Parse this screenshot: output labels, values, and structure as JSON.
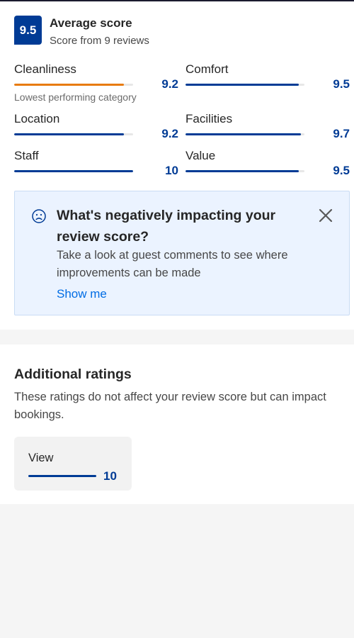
{
  "summary": {
    "score": "9.5",
    "title": "Average score",
    "subtitle": "Score from 9 reviews"
  },
  "ratings": [
    {
      "label": "Cleanliness",
      "value": "9.2",
      "fraction": 0.92,
      "note": "Lowest performing category",
      "bar_color": "#e87b0e"
    },
    {
      "label": "Comfort",
      "value": "9.5",
      "fraction": 0.95
    },
    {
      "label": "Location",
      "value": "9.2",
      "fraction": 0.92
    },
    {
      "label": "Facilities",
      "value": "9.7",
      "fraction": 0.97
    },
    {
      "label": "Staff",
      "value": "10",
      "fraction": 1.0
    },
    {
      "label": "Value",
      "value": "9.5",
      "fraction": 0.95
    }
  ],
  "banner": {
    "title": "What's negatively impacting your review score?",
    "text": "Take a look at guest comments to see where improvements can be made",
    "link": "Show me"
  },
  "additional": {
    "title": "Additional ratings",
    "description": "These ratings do not affect your review score but can impact bookings.",
    "items": [
      {
        "label": "View",
        "value": "10",
        "fraction": 1.0
      }
    ]
  },
  "colors": {
    "brand": "#003b95",
    "warning": "#e87b0e",
    "link": "#006ce4",
    "banner_bg": "#ebf3ff"
  },
  "icons": {
    "banner_icon": "sad-face-icon",
    "dismiss_icon": "close-icon"
  }
}
